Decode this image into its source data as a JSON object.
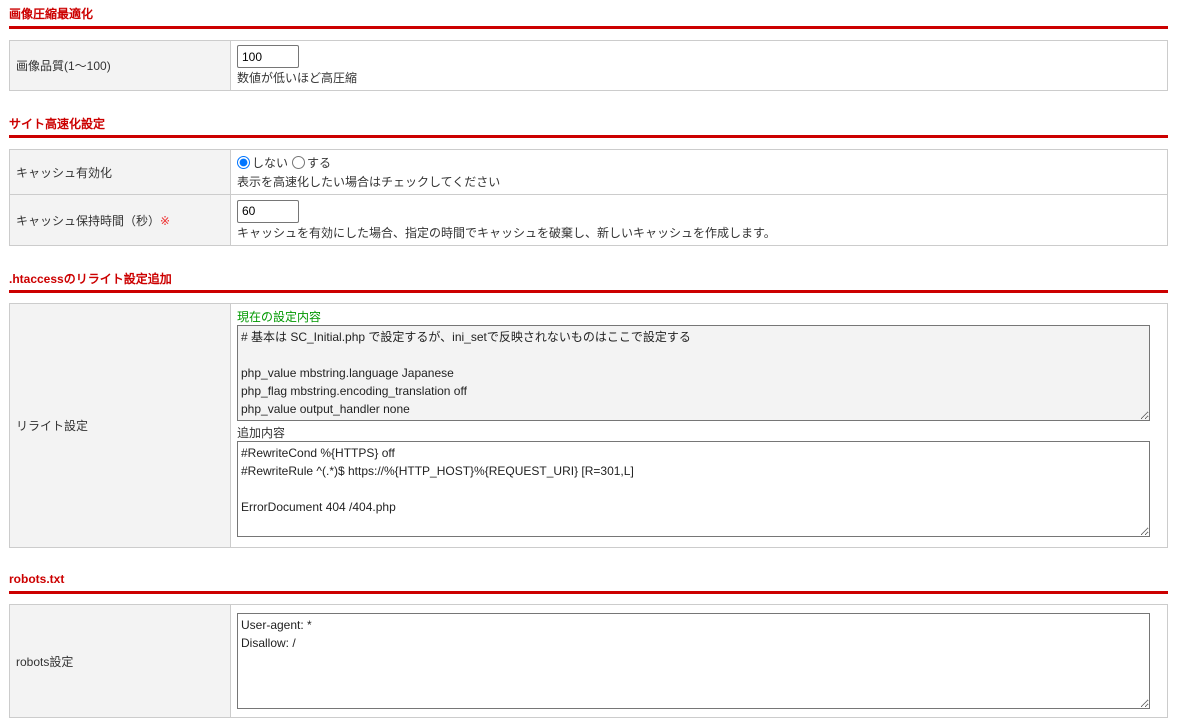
{
  "sections": [
    {
      "title": "画像圧縮最適化",
      "rows": [
        {
          "label": "画像品質(1〜100)",
          "value": "100",
          "note": "数値が低いほど高圧縮"
        }
      ]
    },
    {
      "title": "サイト高速化設定",
      "rows": [
        {
          "label": "キャッシュ有効化",
          "options": [
            "しない",
            "する"
          ],
          "selected": "しない",
          "note": "表示を高速化したい場合はチェックしてください"
        },
        {
          "label": "キャッシュ保持時間（秒）",
          "required_mark": "※",
          "value": "60",
          "note": "キャッシュを有効にした場合、指定の時間でキャッシュを破棄し、新しいキャッシュを作成します。"
        }
      ]
    },
    {
      "title": ".htaccessのリライト設定追加",
      "rows": [
        {
          "label": "リライト設定",
          "current_label": "現在の設定内容",
          "current_value": "# 基本は SC_Initial.php で設定するが、ini_setで反映されないものはここで設定する\n\nphp_value mbstring.language Japanese\nphp_flag mbstring.encoding_translation off\nphp_value output_handler none",
          "add_label": "追加内容",
          "add_value": "#RewriteCond %{HTTPS} off\n#RewriteRule ^(.*)$ https://%{HTTP_HOST}%{REQUEST_URI} [R=301,L]\n\nErrorDocument 404 /404.php"
        }
      ]
    },
    {
      "title": "robots.txt",
      "rows": [
        {
          "label": "robots設定",
          "value": "User-agent: *\nDisallow: /"
        }
      ]
    }
  ]
}
